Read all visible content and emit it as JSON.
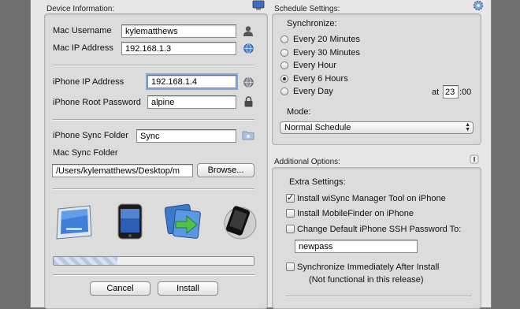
{
  "device": {
    "title": "Device Information:",
    "mac_username_label": "Mac Username",
    "mac_username_value": "kylematthews",
    "mac_ip_label": "Mac IP Address",
    "mac_ip_value": "192.168.1.3",
    "iphone_ip_label": "iPhone IP Address",
    "iphone_ip_value": "192.168.1.4",
    "iphone_password_label": "iPhone Root Password",
    "iphone_password_value": "alpine",
    "iphone_sync_folder_label": "iPhone Sync Folder",
    "iphone_sync_folder_value": "Sync",
    "mac_sync_folder_label": "Mac Sync Folder",
    "mac_sync_folder_value": "/Users/kylematthews/Desktop/m",
    "browse_label": "Browse...",
    "progress_fraction": 0.32,
    "cancel_label": "Cancel",
    "install_label": "Install"
  },
  "schedule": {
    "title": "Schedule Settings:",
    "synchronize_label": "Synchronize:",
    "options": [
      "Every 20 Minutes",
      "Every 30 Minutes",
      "Every Hour",
      "Every 6 Hours",
      "Every Day"
    ],
    "selected_index": 3,
    "at_label": "at",
    "hour_value": "23",
    "minute_value": ":00",
    "mode_label": "Mode:",
    "mode_value": "Normal Schedule"
  },
  "additional": {
    "title": "Additional Options:",
    "extra_label": "Extra Settings:",
    "opt_wisync": "Install wiSync Manager Tool on iPhone",
    "opt_wisync_checked": true,
    "opt_mobilefinder": "Install MobileFinder on iPhone",
    "opt_mobilefinder_checked": false,
    "opt_ssh": "Change Default iPhone SSH Password To:",
    "opt_ssh_checked": false,
    "ssh_password_value": "newpass",
    "opt_sync_now": "Synchronize Immediately After Install",
    "opt_sync_now_checked": false,
    "sync_now_note": "(Not functional in this release)"
  },
  "colors": {
    "window_bg": "#e7e7e7",
    "panel_bg": "#dcdcdc",
    "focus_ring": "#7fa9da"
  }
}
